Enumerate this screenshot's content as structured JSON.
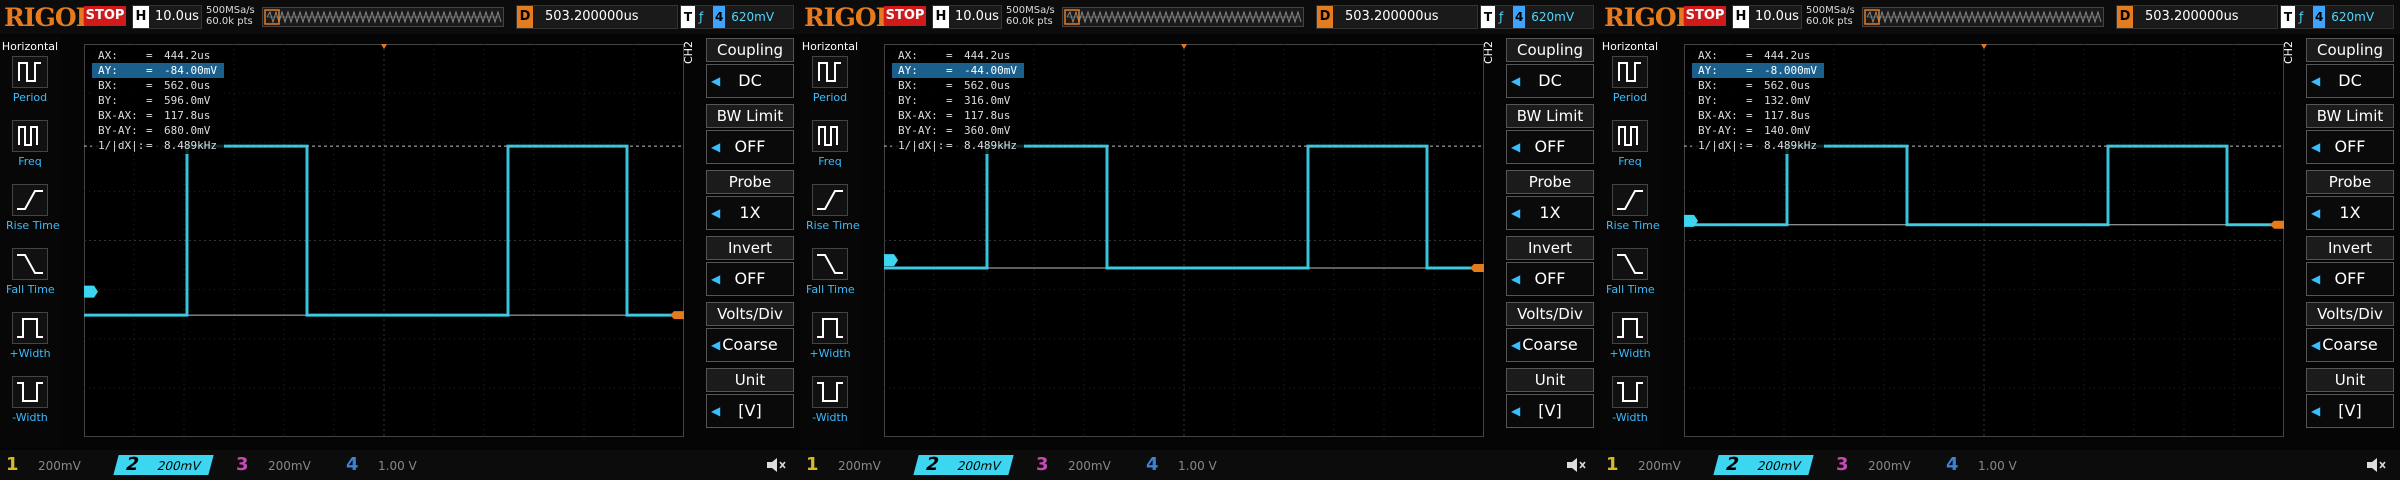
{
  "colors": {
    "ch1": "#d9b825",
    "ch2": "#3cd6f0",
    "ch3": "#c74ab3",
    "ch4": "#3a82d8",
    "accent": "#e47b1f",
    "stop": "#d11a1a"
  },
  "shared": {
    "logo": "RIGOL",
    "status": "STOP",
    "h_label": "H",
    "timebase": "10.0us",
    "sample_rate": "500MSa/s",
    "mem_depth": "60.0k pts",
    "d_label": "D",
    "delay": "503.200000us",
    "t_label": "T",
    "trig_source": "4",
    "trig_level": "620mV",
    "ch_side_label": "CH2",
    "left_menu_title": "Horizontal",
    "left_menu": [
      "Period",
      "Freq",
      "Rise Time",
      "Fall Time",
      "+Width",
      "-Width"
    ],
    "right_menu": [
      {
        "title": "Coupling",
        "value": "DC"
      },
      {
        "title": "BW Limit",
        "value": "OFF"
      },
      {
        "title": "Probe",
        "value": "1X"
      },
      {
        "title": "Invert",
        "value": "OFF"
      },
      {
        "title": "Volts/Div",
        "value": "Coarse"
      },
      {
        "title": "Unit",
        "value": "[V]"
      }
    ],
    "channels": [
      {
        "num": "1",
        "scale": "200mV"
      },
      {
        "num": "2",
        "scale": "200mV"
      },
      {
        "num": "3",
        "scale": "200mV"
      },
      {
        "num": "4",
        "scale": "1.00 V"
      }
    ],
    "eq": "="
  },
  "screens": [
    {
      "cursor": [
        {
          "label": "AX:",
          "value": "444.2us"
        },
        {
          "label": "AY:",
          "value": "-84.00mV",
          "selected": true
        },
        {
          "label": "BX:",
          "value": "562.0us"
        },
        {
          "label": "BY:",
          "value": "596.0mV"
        },
        {
          "label": "BX-AX:",
          "value": "117.8us"
        },
        {
          "label": "BY-AY:",
          "value": "680.0mV"
        },
        {
          "label": "1/|dX|:",
          "value": "8.489kHz"
        }
      ],
      "wave": {
        "high": 0.26,
        "low": 0.69,
        "dashA": 0.26,
        "dashB": 0.69,
        "start_low": true,
        "ch2_marker": 0.63
      }
    },
    {
      "cursor": [
        {
          "label": "AX:",
          "value": "444.2us"
        },
        {
          "label": "AY:",
          "value": "-44.00mV",
          "selected": true
        },
        {
          "label": "BX:",
          "value": "562.0us"
        },
        {
          "label": "BY:",
          "value": "316.0mV"
        },
        {
          "label": "BX-AX:",
          "value": "117.8us"
        },
        {
          "label": "BY-AY:",
          "value": "360.0mV"
        },
        {
          "label": "1/|dX|:",
          "value": "8.489kHz"
        }
      ],
      "wave": {
        "high": 0.26,
        "low": 0.57,
        "dashA": 0.26,
        "dashB": 0.57,
        "start_low": true,
        "ch2_marker": 0.55
      }
    },
    {
      "cursor": [
        {
          "label": "AX:",
          "value": "444.2us"
        },
        {
          "label": "AY:",
          "value": "-8.000mV",
          "selected": true
        },
        {
          "label": "BX:",
          "value": "562.0us"
        },
        {
          "label": "BY:",
          "value": "132.0mV"
        },
        {
          "label": "BX-AX:",
          "value": "117.8us"
        },
        {
          "label": "BY-AY:",
          "value": "140.0mV"
        },
        {
          "label": "1/|dX|:",
          "value": "8.489kHz"
        }
      ],
      "wave": {
        "high": 0.26,
        "low": 0.46,
        "dashA": 0.26,
        "dashB": 0.46,
        "start_low": true,
        "ch2_marker": 0.45
      }
    }
  ]
}
